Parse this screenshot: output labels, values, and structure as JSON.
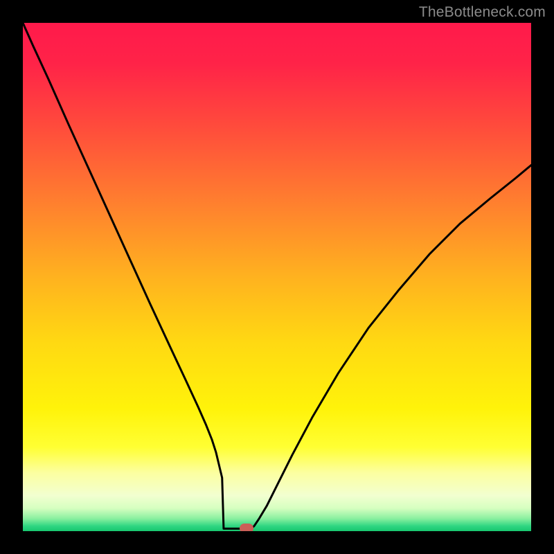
{
  "watermark": "TheBottleneck.com",
  "colors": {
    "gradient_stops": [
      {
        "offset": 0.0,
        "color": "#ff1a4b"
      },
      {
        "offset": 0.08,
        "color": "#ff2348"
      },
      {
        "offset": 0.2,
        "color": "#ff4a3c"
      },
      {
        "offset": 0.35,
        "color": "#ff7e2f"
      },
      {
        "offset": 0.5,
        "color": "#ffb21f"
      },
      {
        "offset": 0.63,
        "color": "#ffd912"
      },
      {
        "offset": 0.76,
        "color": "#fff30a"
      },
      {
        "offset": 0.835,
        "color": "#ffff33"
      },
      {
        "offset": 0.885,
        "color": "#fcffa0"
      },
      {
        "offset": 0.93,
        "color": "#f2ffd0"
      },
      {
        "offset": 0.955,
        "color": "#d6ffc0"
      },
      {
        "offset": 0.975,
        "color": "#8bf0a0"
      },
      {
        "offset": 0.99,
        "color": "#2fd682"
      },
      {
        "offset": 1.0,
        "color": "#17c76f"
      }
    ],
    "curve": "#000000",
    "marker": "#cb5f58",
    "frame": "#000000",
    "watermark_text": "#8b8b8b"
  },
  "chart_data": {
    "type": "line",
    "title": "",
    "xlabel": "",
    "ylabel": "",
    "xlim": [
      0,
      1
    ],
    "ylim": [
      0,
      1
    ],
    "grid": false,
    "legend": false,
    "series": [
      {
        "name": "bottleneck-curve",
        "x": [
          0.0,
          0.02,
          0.05,
          0.09,
          0.13,
          0.17,
          0.21,
          0.25,
          0.29,
          0.32,
          0.345,
          0.36,
          0.372,
          0.38,
          0.386,
          0.392,
          0.397,
          0.402,
          0.41,
          0.42,
          0.43,
          0.437,
          0.442,
          0.448,
          0.455,
          0.465,
          0.48,
          0.5,
          0.53,
          0.57,
          0.62,
          0.68,
          0.74,
          0.8,
          0.86,
          0.92,
          0.97,
          1.0
        ],
        "y": [
          1.0,
          0.955,
          0.89,
          0.8,
          0.712,
          0.624,
          0.536,
          0.448,
          0.362,
          0.298,
          0.244,
          0.21,
          0.18,
          0.155,
          0.13,
          0.105,
          0.08,
          0.055,
          0.03,
          0.015,
          0.008,
          0.004,
          0.002,
          0.004,
          0.01,
          0.025,
          0.05,
          0.09,
          0.15,
          0.225,
          0.31,
          0.4,
          0.475,
          0.545,
          0.605,
          0.655,
          0.695,
          0.72
        ]
      }
    ],
    "marker": {
      "x": 0.44,
      "y": 0.005
    },
    "flat_bottom": {
      "x_start": 0.395,
      "x_end": 0.448,
      "y": 0.005
    }
  }
}
